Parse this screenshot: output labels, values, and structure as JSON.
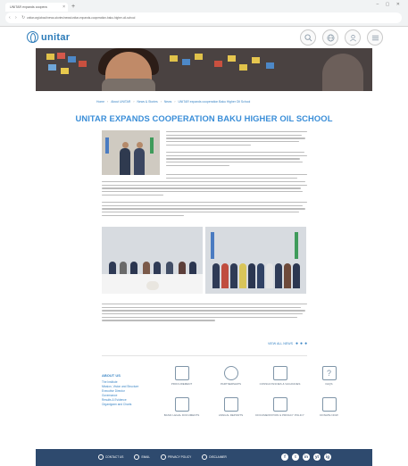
{
  "browser": {
    "tab_title": "UNITAR expands coopera",
    "tab_close": "×",
    "new_tab": "+",
    "url": "unitar.org/about/news-stories/news/unitar-expands-cooperation-baku-higher-oil-school",
    "nav": "‹ › ↻",
    "window_controls": "– ▢ ✕"
  },
  "header": {
    "logo_text": "unitar",
    "icons": [
      "search-icon",
      "globe-icon",
      "user-icon",
      "menu-icon"
    ]
  },
  "breadcrumb": [
    "Home",
    "About UNITAR",
    "News & Stories",
    "News",
    "UNITAR expands cooperation Baku Higher Oil School"
  ],
  "article": {
    "title": "UNITAR EXPANDS COOPERATION BAKU HIGHER OIL SCHOOL"
  },
  "more_link": "VIEW ALL NEWS",
  "about": {
    "title": "ABOUT US",
    "links": [
      "The Institute",
      "Mission, Vision and Structure",
      "Executive Director",
      "Governance",
      "Results & Evidence",
      "Organigram and Charts"
    ]
  },
  "footer_items": [
    {
      "label": "PROCUREMENT",
      "icon": "briefcase-icon"
    },
    {
      "label": "PARTNERSHIPS",
      "icon": "people-icon"
    },
    {
      "label": "CONSULTANCIES & VACANCIES",
      "icon": "document-icon"
    },
    {
      "label": "FAQS",
      "icon": "question-icon"
    },
    {
      "label": "BASIC LEGAL DOCUMENTS",
      "icon": "pen-document-icon"
    },
    {
      "label": "ANNUAL REPORTS",
      "icon": "report-icon"
    },
    {
      "label": "DOCUMENTATION & PRIVACY POLICY",
      "icon": "file-text-icon"
    },
    {
      "label": "DONATE NOW",
      "icon": "envelope-icon"
    }
  ],
  "bottom_bar": {
    "links": [
      "CONTACT US",
      "EMAIL",
      "PRIVACY POLICY",
      "DISCLAIMER"
    ],
    "social": [
      "f",
      "t",
      "in",
      "yt",
      "ig"
    ]
  }
}
